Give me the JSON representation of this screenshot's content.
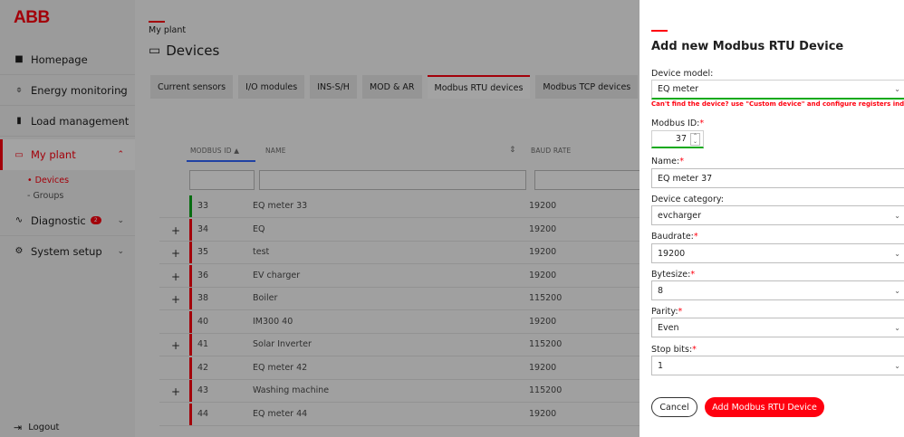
{
  "brand": "ABB",
  "sidebar": {
    "items": [
      {
        "label": "Homepage",
        "icon": "home-icon"
      },
      {
        "label": "Energy monitoring",
        "icon": "energy-icon"
      },
      {
        "label": "Load management",
        "icon": "chart-icon"
      },
      {
        "label": "My plant",
        "icon": "plant-icon"
      },
      {
        "label": "Diagnostic",
        "icon": "pulse-icon",
        "badge": "2"
      },
      {
        "label": "System setup",
        "icon": "gear-icon"
      }
    ],
    "sub_items": [
      "• Devices",
      "- Groups"
    ],
    "logout": "Logout"
  },
  "main": {
    "breadcrumb": "My plant",
    "title": "Devices",
    "tabs": [
      "Current sensors",
      "I/O modules",
      "INS-S/H",
      "MOD & AR",
      "Modbus RTU devices",
      "Modbus TCP devices"
    ],
    "active_tab": "Modbus RTU devices",
    "columns": [
      "MODBUS ID ▲",
      "NAME",
      "BAUD RATE"
    ],
    "rows": [
      {
        "expand": "",
        "id": "33",
        "name": "EQ meter 33",
        "baud": "19200",
        "status": "green"
      },
      {
        "expand": "+",
        "id": "34",
        "name": "EQ",
        "baud": "19200",
        "status": "red"
      },
      {
        "expand": "+",
        "id": "35",
        "name": "test",
        "baud": "19200",
        "status": "red"
      },
      {
        "expand": "+",
        "id": "36",
        "name": "EV charger",
        "baud": "19200",
        "status": "red"
      },
      {
        "expand": "+",
        "id": "38",
        "name": "Boiler",
        "baud": "115200",
        "status": "red"
      },
      {
        "expand": "",
        "id": "40",
        "name": "IM300 40",
        "baud": "19200",
        "status": "red"
      },
      {
        "expand": "+",
        "id": "41",
        "name": "Solar Inverter",
        "baud": "115200",
        "status": "red"
      },
      {
        "expand": "",
        "id": "42",
        "name": "EQ meter 42",
        "baud": "19200",
        "status": "red"
      },
      {
        "expand": "+",
        "id": "43",
        "name": "Washing machine",
        "baud": "115200",
        "status": "red"
      },
      {
        "expand": "",
        "id": "44",
        "name": "EQ meter 44",
        "baud": "19200",
        "status": "red"
      }
    ]
  },
  "panel": {
    "title": "Add new Modbus RTU Device",
    "device_model_label": "Device model:",
    "device_model_value": "EQ meter",
    "hint": "Can't find the device? use \"Custom device\" and configure registers individually",
    "modbus_id_label": "Modbus ID:",
    "modbus_id_value": "37",
    "name_label": "Name:",
    "name_value": "EQ meter 37",
    "category_label": "Device category:",
    "category_value": "evcharger",
    "baudrate_label": "Baudrate:",
    "baudrate_value": "19200",
    "bytesize_label": "Bytesize:",
    "bytesize_value": "8",
    "parity_label": "Parity:",
    "parity_value": "Even",
    "stopbits_label": "Stop bits:",
    "stopbits_value": "1",
    "cancel_label": "Cancel",
    "submit_label": "Add Modbus RTU Device"
  },
  "colors": {
    "accent": "#ff000f",
    "ok": "#0ca919",
    "link": "#3366ff"
  }
}
